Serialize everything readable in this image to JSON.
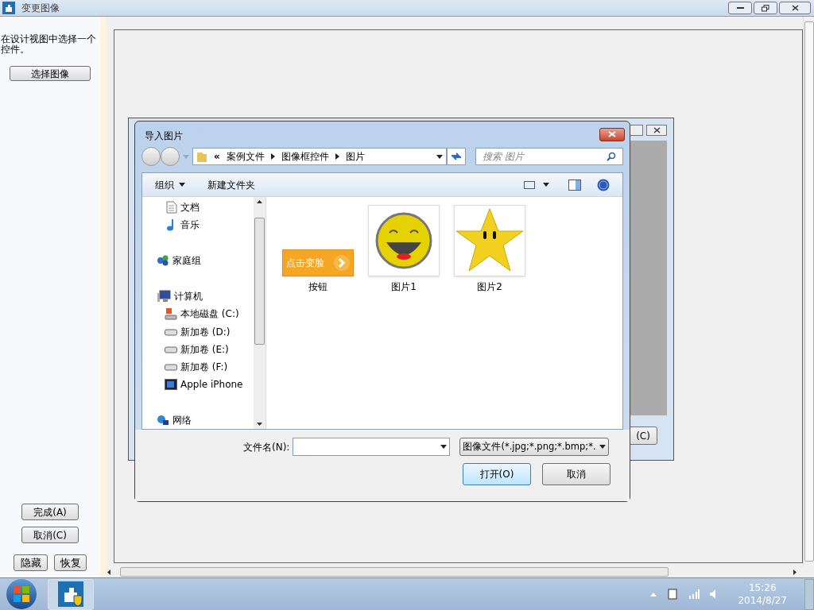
{
  "window": {
    "title": "变更图像"
  },
  "left_panel": {
    "hint": "在设计视图中选择一个控件。",
    "select_button": "选择图像",
    "finish_button": "完成(A)",
    "cancel_button": "取消(C)",
    "hide_button": "隐藏",
    "restore_button": "恢复"
  },
  "background_dialog": {
    "partial_button": "(C)"
  },
  "dialog": {
    "title": "导入图片",
    "breadcrumb": {
      "overflow": "«",
      "items": [
        "案例文件",
        "图像框控件",
        "图片"
      ]
    },
    "search": {
      "placeholder": "搜索 图片"
    },
    "toolbar": {
      "organize": "组织",
      "new_folder": "新建文件夹"
    },
    "nav": [
      {
        "label": "文档",
        "kind": "document"
      },
      {
        "label": "音乐",
        "kind": "music"
      },
      {
        "label": "家庭组",
        "kind": "homegroup"
      },
      {
        "label": "计算机",
        "kind": "computer",
        "children": [
          {
            "label": "本地磁盘 (C:)",
            "kind": "system-drive"
          },
          {
            "label": "新加卷 (D:)",
            "kind": "drive"
          },
          {
            "label": "新加卷 (E:)",
            "kind": "drive"
          },
          {
            "label": "新加卷 (F:)",
            "kind": "drive"
          },
          {
            "label": "Apple iPhone",
            "kind": "phone"
          }
        ]
      },
      {
        "label": "网络",
        "kind": "network"
      }
    ],
    "files": [
      {
        "name": "按钮",
        "kind": "button-image",
        "image_text": "点击变脸"
      },
      {
        "name": "图片1",
        "kind": "smiley"
      },
      {
        "name": "图片2",
        "kind": "star"
      }
    ],
    "file_name": {
      "label": "文件名(N):"
    },
    "file_type": "图像文件(*.jpg;*.png;*.bmp;*.",
    "open_button": "打开(O)",
    "cancel_button": "取消"
  },
  "taskbar": {
    "time": "15:26",
    "date": "2014/8/27"
  }
}
